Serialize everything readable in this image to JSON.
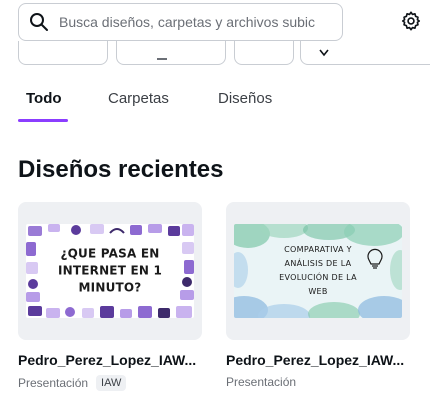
{
  "search": {
    "placeholder": "Busca diseños, carpetas y archivos subic",
    "value": ""
  },
  "icons": {
    "search": "search-icon",
    "settings": "gear-icon"
  },
  "tabs": [
    {
      "label": "Todo",
      "active": true
    },
    {
      "label": "Carpetas",
      "active": false
    },
    {
      "label": "Diseños",
      "active": false
    }
  ],
  "section": {
    "title": "Diseños recientes"
  },
  "designs": [
    {
      "title": "Pedro_Perez_Lopez_IAW...",
      "type": "Presentación",
      "tag": "IAW",
      "thumbnail_text": "¿QUE PASA EN INTERNET EN 1 MINUTO?"
    },
    {
      "title": "Pedro_Perez_Lopez_IAW...",
      "type": "Presentación",
      "tag": "",
      "thumbnail_text": "COMPARATIVA Y ANÁLISIS DE LA EVOLUCIÓN DE LA WEB"
    }
  ],
  "colors": {
    "accent": "#8b3dff",
    "text": "#0e1318",
    "muted": "#6b6f76",
    "card_bg": "#eef0f3",
    "border": "#c9cdd3"
  }
}
